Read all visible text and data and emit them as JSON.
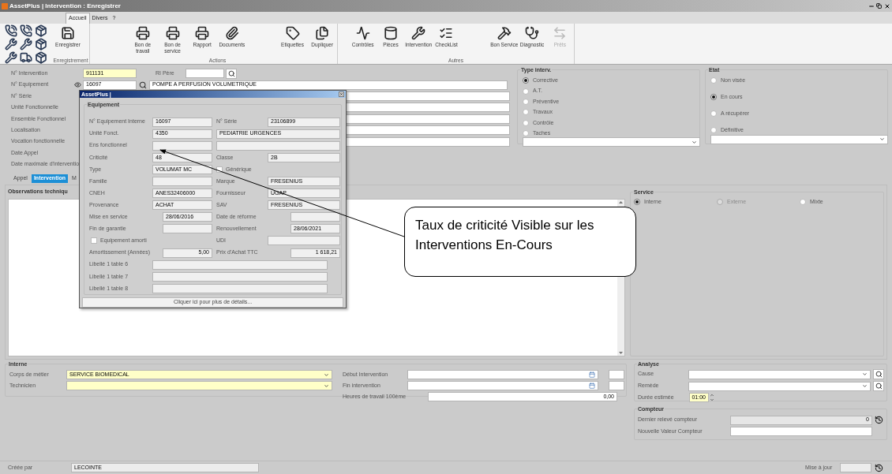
{
  "window": {
    "title": "AssetPlus | Intervention : Enregistrer"
  },
  "menu_tabs": [
    {
      "label": "Accueil",
      "selected": true
    },
    {
      "label": "Divers",
      "selected": false
    },
    {
      "label": "?",
      "selected": false
    }
  ],
  "ribbon": {
    "groups": [
      {
        "label": "Enregistrement",
        "buttons": [
          {
            "label": "Enregistrer",
            "disabled": false
          }
        ]
      },
      {
        "label": "Actions",
        "buttons": [
          {
            "label": "Bon de travail",
            "disabled": false
          },
          {
            "label": "Bon de service",
            "disabled": false
          },
          {
            "label": "Rapport",
            "disabled": false
          },
          {
            "label": "Documents",
            "disabled": false
          },
          {
            "label": "Etiquettes",
            "disabled": false
          },
          {
            "label": "Dupliquer",
            "disabled": false
          }
        ]
      },
      {
        "label": "Autres",
        "buttons": [
          {
            "label": "Contrôles",
            "disabled": false
          },
          {
            "label": "Pièces",
            "disabled": false
          },
          {
            "label": "Intervention",
            "disabled": false
          },
          {
            "label": "CheckList",
            "disabled": false
          },
          {
            "label": "Bon Service",
            "disabled": false
          },
          {
            "label": "Diagnostic",
            "disabled": false
          },
          {
            "label": "Prêts",
            "disabled": true
          }
        ]
      }
    ]
  },
  "form": {
    "rows": [
      {
        "kind": "intervention",
        "label": "N° Intervention",
        "value": "911131",
        "label2": "RI Père"
      },
      {
        "kind": "equipment",
        "label": "N° Equipement",
        "value": "16097",
        "value2": "POMPE A PERFUSION VOLUMETRIQUE"
      },
      {
        "kind": "field",
        "label": "N° Série"
      },
      {
        "kind": "field",
        "label": "Unité Fonctionnelle"
      },
      {
        "kind": "field",
        "label": "Ensemble Fonctionnel"
      },
      {
        "kind": "field",
        "label": "Localisation"
      },
      {
        "kind": "field",
        "label": "Vocation fonctionnelle"
      },
      {
        "kind": "label",
        "label": "Date Appel"
      },
      {
        "kind": "label",
        "label": "Date maximale d'interventio"
      }
    ]
  },
  "type_interv": {
    "title": "Type interv.",
    "options": [
      {
        "label": "Corrective",
        "selected": true
      },
      {
        "label": "A.T.",
        "selected": false
      },
      {
        "label": "Préventive",
        "selected": false
      },
      {
        "label": "Travaux",
        "selected": false
      },
      {
        "label": "Contrôle",
        "selected": false
      },
      {
        "label": "Taches",
        "selected": false
      }
    ]
  },
  "etat": {
    "title": "Etat",
    "options": [
      {
        "label": "Non visée",
        "selected": false
      },
      {
        "label": "En cours",
        "selected": true
      },
      {
        "label": "A récupérer",
        "selected": false
      },
      {
        "label": "Définitive",
        "selected": false
      }
    ]
  },
  "tabs": [
    {
      "label": "Appel",
      "selected": false
    },
    {
      "label": "Intervention",
      "selected": true
    },
    {
      "label": "M",
      "selected": false
    }
  ],
  "observations": {
    "label": "Observations techniqu"
  },
  "service": {
    "title": "Service",
    "options": [
      {
        "label": "Interne",
        "selected": true,
        "disabled": false
      },
      {
        "label": "Externe",
        "selected": false,
        "disabled": true
      },
      {
        "label": "Mixte",
        "selected": false,
        "disabled": false
      }
    ]
  },
  "interne": {
    "title": "Interne",
    "fields": [
      {
        "label": "Corps de métier",
        "value": "SERVICE BIOMEDICAL"
      },
      {
        "label": "Technicien"
      }
    ],
    "dates": [
      {
        "label": "Début Intervention"
      },
      {
        "label": "Fin intervention"
      }
    ],
    "hours": {
      "label": "Heures de travail 100ème",
      "value": "0,00"
    }
  },
  "analyse": {
    "title": "Analyse",
    "fields": [
      {
        "label": "Cause"
      },
      {
        "label": "Remède"
      }
    ],
    "duration": {
      "label": "Durée estimée",
      "value": "01:00"
    }
  },
  "compteur": {
    "title": "Compteur",
    "last": {
      "label": "Dernier relevé compteur",
      "value": "0"
    },
    "new": {
      "label": "Nouvelle Valeur Compteur"
    }
  },
  "status_bar": {
    "created_label": "Créée par",
    "created_value": "LECOINTE",
    "updated_label": "Mise à jour"
  },
  "popup": {
    "title": "AssetPlus |",
    "group": "Equipement",
    "rows": [
      {
        "kind": "pair",
        "label": "N° Equipement Interne",
        "value": "16097",
        "label2": "N° Série",
        "value2": "23106899"
      },
      {
        "kind": "wide",
        "label": "Unité Fonct.",
        "value": "4350",
        "value2": "PEDIATRIE URGENCES"
      },
      {
        "kind": "wide",
        "label": "Ens fonctionnel"
      },
      {
        "kind": "pair",
        "label": "Criticité",
        "value": "48",
        "label2": "Classe",
        "value2": "2B"
      },
      {
        "kind": "check_right",
        "label": "Type",
        "value": "VOLUMAT MC",
        "check": {
          "label": "Générique",
          "checked": false
        }
      },
      {
        "kind": "pair",
        "label": "Famille",
        "label2": "Marque",
        "value2": "FRESENIUS"
      },
      {
        "kind": "pair",
        "label": "CNEH",
        "value": "ANES32406000",
        "label2": "Fournisseur",
        "value2": "UGAP"
      },
      {
        "kind": "pair",
        "label": "Provenance",
        "value": "ACHAT",
        "label2": "SAV",
        "value2": "FRESENIUS"
      },
      {
        "kind": "date",
        "label": "Mise en service",
        "value": "28/06/2016",
        "label2": "Date de réforme"
      },
      {
        "kind": "date",
        "label": "Fin de garantie",
        "label2": "Renouvellement",
        "value2": "28/06/2021"
      },
      {
        "kind": "check_left",
        "check": {
          "label": "Equipement amorti",
          "checked": false
        },
        "label2": "UDI"
      },
      {
        "kind": "amount",
        "label": "Amortissement (Années)",
        "value": "5,00",
        "label2": "Prix d'Achat TTC",
        "value2": "1 618,21"
      },
      {
        "kind": "long",
        "label": "Libellé 1 table 6"
      },
      {
        "kind": "long",
        "label": "Libellé 1 table 7"
      },
      {
        "kind": "long",
        "label": "Libellé 1 table 8"
      }
    ],
    "button": "Cliquer ici pour plus de détails..."
  },
  "annotation": {
    "text": "Taux de criticité Visible sur les Interventions En-Cours"
  }
}
